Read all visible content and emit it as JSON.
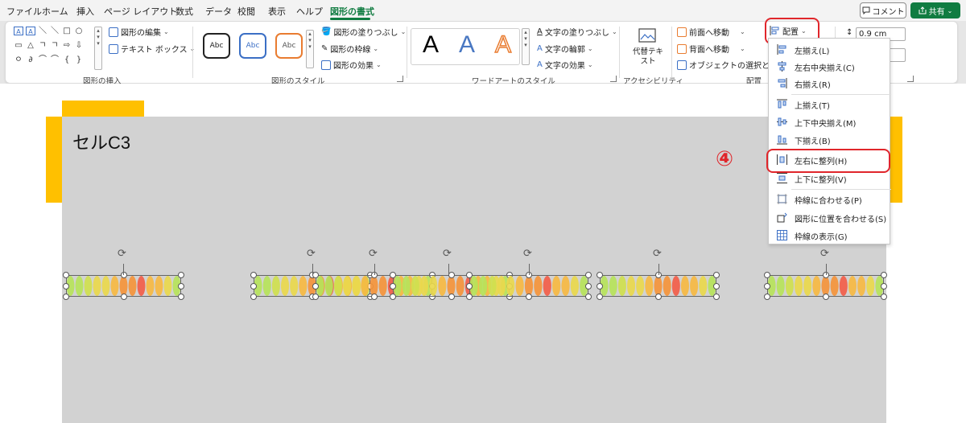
{
  "tabs": [
    "ファイル",
    "ホーム",
    "挿入",
    "ページ レイアウト",
    "数式",
    "データ",
    "校閲",
    "表示",
    "ヘルプ",
    "図形の書式"
  ],
  "active_tab": "図形の書式",
  "comment_label": "コメント",
  "share_label": "共有",
  "ribbon": {
    "insert_shapes": {
      "edit_shape": "図形の編集",
      "text_box": "テキスト ボックス",
      "label": "図形の挿入",
      "shapes": [
        "A",
        "A",
        "＼",
        "＼",
        "□",
        "○",
        "▭",
        "△",
        "ㄱ",
        "ㄱ",
        "⇨",
        "⇩",
        "ㅇ",
        "∂",
        "⌒",
        "⌒",
        "{",
        "}"
      ]
    },
    "shape_styles": {
      "samples": [
        "Abc",
        "Abc",
        "Abc"
      ],
      "fill": "図形の塗りつぶし",
      "outline": "図形の枠線",
      "effects": "図形の効果",
      "label": "図形のスタイル"
    },
    "wordart": {
      "samples": [
        "A",
        "A",
        "A"
      ],
      "text_fill": "文字の塗りつぶし",
      "text_outline": "文字の輪郭",
      "text_effects": "文字の効果",
      "label": "ワードアートのスタイル"
    },
    "accessibility": {
      "alt_text": "代替テキスト",
      "label": "アクセシビリティ"
    },
    "arrange": {
      "bring_forward": "前面へ移動",
      "send_backward": "背面へ移動",
      "selection_pane": "オブジェクトの選択と表示",
      "arrange_button": "配置",
      "label": "配置"
    },
    "size": {
      "height": "0.9 cm"
    }
  },
  "canvas": {
    "title": "セルC3"
  },
  "dropdown_items": [
    {
      "label": "左揃え(L)",
      "icon": "align-left-icon"
    },
    {
      "label": "左右中央揃え(C)",
      "icon": "align-center-icon"
    },
    {
      "label": "右揃え(R)",
      "icon": "align-right-icon"
    },
    {
      "label": "上揃え(T)",
      "icon": "align-top-icon"
    },
    {
      "label": "上下中央揃え(M)",
      "icon": "align-middle-icon"
    },
    {
      "label": "下揃え(B)",
      "icon": "align-bottom-icon"
    },
    {
      "label": "左右に整列(H)",
      "icon": "distribute-horizontal-icon"
    },
    {
      "label": "上下に整列(V)",
      "icon": "distribute-vertical-icon"
    },
    {
      "label": "枠線に合わせる(P)",
      "icon": "snap-to-grid-icon"
    },
    {
      "label": "図形に位置を合わせる(S)",
      "icon": "snap-to-shape-icon"
    },
    {
      "label": "枠線の表示(G)",
      "icon": "view-gridlines-icon"
    }
  ],
  "step_number": "④",
  "colors": {
    "accent": "#107c41",
    "highlight": "#e0262b",
    "gold": "#ffc000",
    "canvas": "#d2d2d2"
  }
}
